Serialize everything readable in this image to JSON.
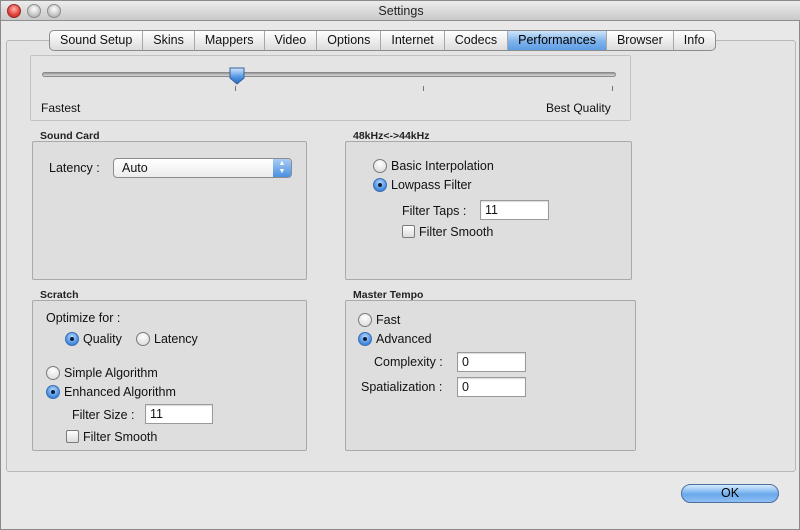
{
  "window": {
    "title": "Settings"
  },
  "tabs": [
    {
      "label": "Sound Setup",
      "active": false
    },
    {
      "label": "Skins",
      "active": false
    },
    {
      "label": "Mappers",
      "active": false
    },
    {
      "label": "Video",
      "active": false
    },
    {
      "label": "Options",
      "active": false
    },
    {
      "label": "Internet",
      "active": false
    },
    {
      "label": "Codecs",
      "active": false
    },
    {
      "label": "Performances",
      "active": true
    },
    {
      "label": "Browser",
      "active": false
    },
    {
      "label": "Info",
      "active": false
    }
  ],
  "quality_slider": {
    "min_label": "Fastest",
    "max_label": "Best Quality",
    "value_fraction": 0.34
  },
  "sound_card": {
    "title": "Sound Card",
    "latency_label": "Latency :",
    "latency_value": "Auto"
  },
  "resample": {
    "title": "48kHz<->44kHz",
    "basic_label": "Basic Interpolation",
    "basic_checked": false,
    "lowpass_label": "Lowpass Filter",
    "lowpass_checked": true,
    "taps_label": "Filter Taps :",
    "taps_value": "11",
    "smooth_label": "Filter Smooth",
    "smooth_checked": false
  },
  "scratch": {
    "title": "Scratch",
    "optimize_label": "Optimize for :",
    "quality_label": "Quality",
    "quality_checked": true,
    "latency_label": "Latency",
    "latency_checked": false,
    "simple_label": "Simple Algorithm",
    "simple_checked": false,
    "enhanced_label": "Enhanced Algorithm",
    "enhanced_checked": true,
    "filter_size_label": "Filter Size :",
    "filter_size_value": "11",
    "smooth_label": "Filter Smooth",
    "smooth_checked": false
  },
  "master_tempo": {
    "title": "Master Tempo",
    "fast_label": "Fast",
    "fast_checked": false,
    "advanced_label": "Advanced",
    "advanced_checked": true,
    "complexity_label": "Complexity :",
    "complexity_value": "0",
    "spatialization_label": "Spatialization :",
    "spatialization_value": "0"
  },
  "ok_label": "OK",
  "colors": {
    "accent": "#5d9ee6",
    "selected_tab": "#7fb2ea"
  }
}
